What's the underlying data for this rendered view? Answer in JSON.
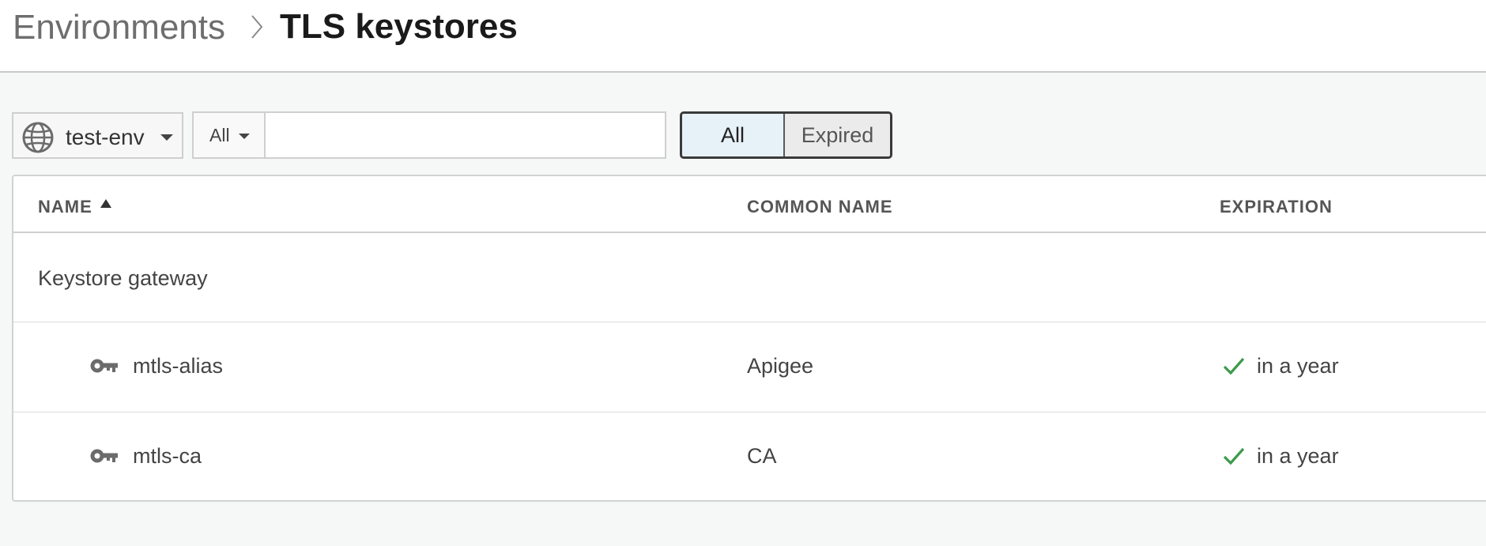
{
  "header": {
    "breadcrumb_root": "Environments",
    "title": "TLS keystores"
  },
  "toolbar": {
    "environment": "test-env",
    "filter_scope": "All",
    "search_value": "",
    "toggle": {
      "all_label": "All",
      "expired_label": "Expired",
      "selected": "All"
    }
  },
  "table": {
    "columns": {
      "name": "NAME",
      "common_name": "COMMON NAME",
      "expiration": "EXPIRATION"
    },
    "sort": {
      "column": "NAME",
      "direction": "ascending"
    },
    "group": {
      "label": "Keystore gateway"
    },
    "rows": [
      {
        "name": "mtls-alias",
        "common_name": "Apigee",
        "expiration": "in a year",
        "status_icon": "check-icon"
      },
      {
        "name": "mtls-ca",
        "common_name": "CA",
        "expiration": "in a year",
        "status_icon": "check-icon"
      }
    ]
  },
  "icons": {
    "environment": "globe-icon",
    "breadcrumb_separator": "chevron-right-icon",
    "row_item": "key-icon",
    "valid": "check-icon"
  },
  "colors": {
    "accent_check": "#3d9a4c",
    "toggle_selected_bg": "#e7f2f8",
    "page_bg": "#f6f7f7"
  }
}
